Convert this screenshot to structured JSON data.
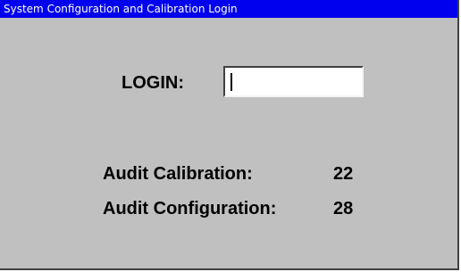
{
  "window": {
    "title": "System Configuration and Calibration Login"
  },
  "login": {
    "label": "LOGIN:",
    "value": "",
    "placeholder": ""
  },
  "audit": {
    "calibration_label": "Audit Calibration:",
    "calibration_value": "22",
    "configuration_label": "Audit Configuration:",
    "configuration_value": "28"
  },
  "colors": {
    "titlebar": "#0000ee",
    "window_bg": "#c0c0c0"
  }
}
